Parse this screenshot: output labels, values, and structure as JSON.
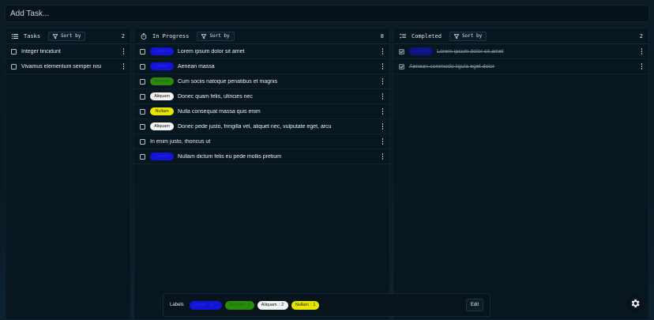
{
  "add_task": {
    "placeholder": "Add Task..."
  },
  "columns": {
    "tasks": {
      "title": "Tasks",
      "sort_label": "Sort by",
      "count": "2",
      "items": [
        {
          "text": "Integer tincidunt"
        },
        {
          "text": "Vivamus elementum semper nisi"
        }
      ]
    },
    "in_progress": {
      "title": "In Progress",
      "sort_label": "Sort by",
      "count": "8",
      "items": [
        {
          "tag": "Lorem",
          "tag_color": "#1414d6",
          "text": "Lorem ipsum dolor sit amet"
        },
        {
          "tag": "Lorem",
          "tag_color": "#1414d6",
          "text": "Aenean massa"
        },
        {
          "tag": "Aenean",
          "tag_color": "#2b8a0c",
          "text": "Cum sociis natoque penatibus et magnis"
        },
        {
          "tag": "Aliquam",
          "tag_color": "#f3f3f3",
          "text": "Donec quam felis, ultricies nec"
        },
        {
          "tag": "Nullam",
          "tag_color": "#e6e600",
          "text": "Nulla consequat massa quis enim"
        },
        {
          "tag": "Aliquam",
          "tag_color": "#f3f3f3",
          "text": "Donec pede justo, fringilla vel, aliquet nec, vulputate eget, arcu"
        },
        {
          "tag": "",
          "text": "In enim justo, rhoncus ut"
        },
        {
          "tag": "Lorem",
          "tag_color": "#1414d6",
          "text": "Nullam dictum felis eu pede mollis pretium"
        }
      ]
    },
    "completed": {
      "title": "Completed",
      "sort_label": "Sort by",
      "count": "2",
      "items": [
        {
          "tag": "Lorem",
          "tag_color": "#1414d6",
          "text": "Lorem ipsum dolor sit amet"
        },
        {
          "tag": "",
          "text": "Aenean commodo ligula eget dolor"
        }
      ]
    }
  },
  "labels_bar": {
    "title": "Labels",
    "labels": [
      {
        "name": "Lorem",
        "count": "3",
        "color": "#1414d6"
      },
      {
        "name": "Aenean",
        "count": "1",
        "color": "#2b8a0c"
      },
      {
        "name": "Aliquam",
        "count": "2",
        "color": "#f3f3f3"
      },
      {
        "name": "Nullam",
        "count": "1",
        "color": "#e6e600"
      }
    ],
    "edit_label": "Edit"
  },
  "icons": {
    "tasks": "list-icon",
    "in_progress": "timer-icon",
    "completed": "checklist-icon",
    "sort": "filter-icon",
    "menu": "kebab-icon",
    "settings": "gear-icon"
  }
}
